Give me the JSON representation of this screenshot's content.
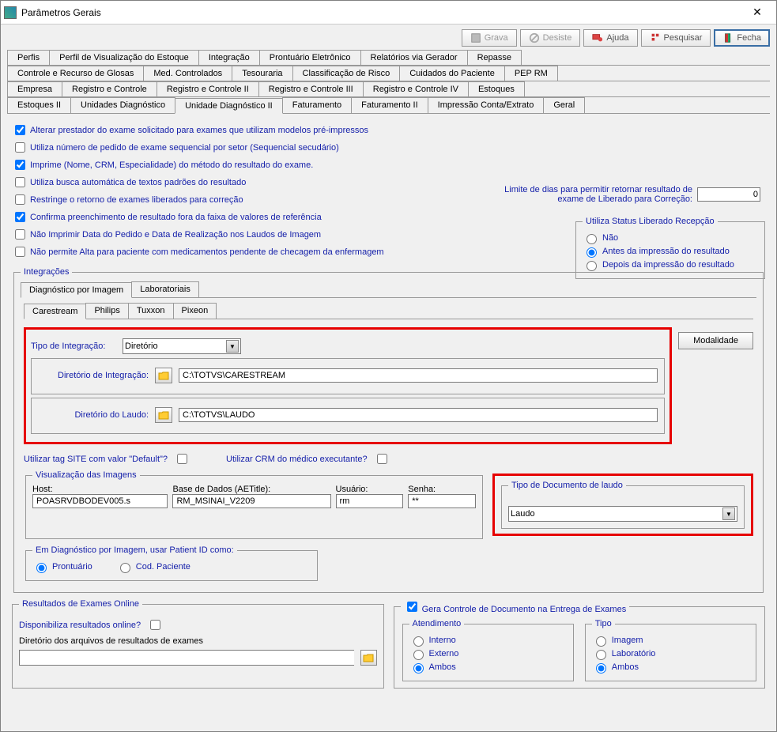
{
  "window": {
    "title": "Parâmetros Gerais"
  },
  "toolbar": {
    "grava": "Grava",
    "desiste": "Desiste",
    "ajuda": "Ajuda",
    "pesquisar": "Pesquisar",
    "fecha": "Fecha"
  },
  "tabs": {
    "row1": [
      "Perfis",
      "Perfil de Visualização do Estoque",
      "Integração",
      "Prontuário Eletrônico",
      "Relatórios via Gerador",
      "Repasse"
    ],
    "row2": [
      "Controle e Recurso de Glosas",
      "Med. Controlados",
      "Tesouraria",
      "Classificação de Risco",
      "Cuidados do Paciente",
      "PEP RM"
    ],
    "row3": [
      "Empresa",
      "Registro e Controle",
      "Registro e Controle II",
      "Registro e Controle III",
      "Registro e Controle IV",
      "Estoques"
    ],
    "row4": [
      "Estoques II",
      "Unidades Diagnóstico",
      "Unidade Diagnóstico II",
      "Faturamento",
      "Faturamento II",
      "Impressão Conta/Extrato",
      "Geral"
    ],
    "active": "Unidade Diagnóstico II"
  },
  "checks": {
    "c1": "Alterar prestador do exame solicitado para exames que utilizam modelos pré-impressos",
    "c2": "Utiliza número de pedido de exame sequencial por setor (Sequencial secudário)",
    "c3": "Imprime (Nome, CRM, Especialidade) do método do resultado do exame.",
    "c4": "Utiliza busca automática de textos padrões do resultado",
    "c5": "Restringe o retorno de exames liberados para correção",
    "c6": "Confirma preenchimento de resultado fora da faixa de valores de referência",
    "c7": "Não Imprimir Data do Pedido e Data de Realização nos Laudos de Imagem",
    "c8": "Não permite Alta para paciente com medicamentos pendente de checagem da enfermagem"
  },
  "limit": {
    "label": "Limite de dias para permitir retornar resultado de exame de Liberado para Correção:",
    "value": "0"
  },
  "status": {
    "legend": "Utiliza Status Liberado Recepção",
    "r1": "Não",
    "r2": "Antes da impressão do resultado",
    "r3": "Depois da impressão do resultado"
  },
  "integracoes": {
    "legend": "Integrações",
    "tabs1": [
      "Diagnóstico por Imagem",
      "Laboratoriais"
    ],
    "tabs2": [
      "Carestream",
      "Philips",
      "Tuxxon",
      "Pixeon"
    ],
    "tipo_integracao_label": "Tipo de Integração:",
    "tipo_integracao_value": "Diretório",
    "modalidade": "Modalidade",
    "dir_integ_label": "Diretório de Integração:",
    "dir_integ_value": "C:\\TOTVS\\CARESTREAM",
    "dir_laudo_label": "Diretório do Laudo:",
    "dir_laudo_value": "C:\\TOTVS\\LAUDO",
    "tag_site_label": "Utilizar tag SITE com valor \"Default\"?",
    "crm_label": "Utilizar CRM do médico executante?",
    "viz_legend": "Visualização das Imagens",
    "host_label": "Host:",
    "host_value": "POASRVDBODEV005.s",
    "base_label": "Base de Dados (AETitle):",
    "base_value": "RM_MSINAI_V2209",
    "user_label": "Usuário:",
    "user_value": "rm",
    "pass_label": "Senha:",
    "pass_value": "**",
    "tipodoc_legend": "Tipo de Documento de laudo",
    "tipodoc_value": "Laudo",
    "patientid_legend": "Em Diagnóstico por Imagem, usar Patient ID como:",
    "patientid_r1": "Prontuário",
    "patientid_r2": "Cod. Paciente"
  },
  "resultados": {
    "legend": "Resultados de Exames Online",
    "disp_label": "Disponibiliza resultados online?",
    "dir_label": "Diretório dos arquivos de resultados de exames"
  },
  "gera": {
    "legend": "Gera Controle de Documento na Entrega de Exames",
    "atend_legend": "Atendimento",
    "atend_r1": "Interno",
    "atend_r2": "Externo",
    "atend_r3": "Ambos",
    "tipo_legend": "Tipo",
    "tipo_r1": "Imagem",
    "tipo_r2": "Laboratório",
    "tipo_r3": "Ambos"
  }
}
